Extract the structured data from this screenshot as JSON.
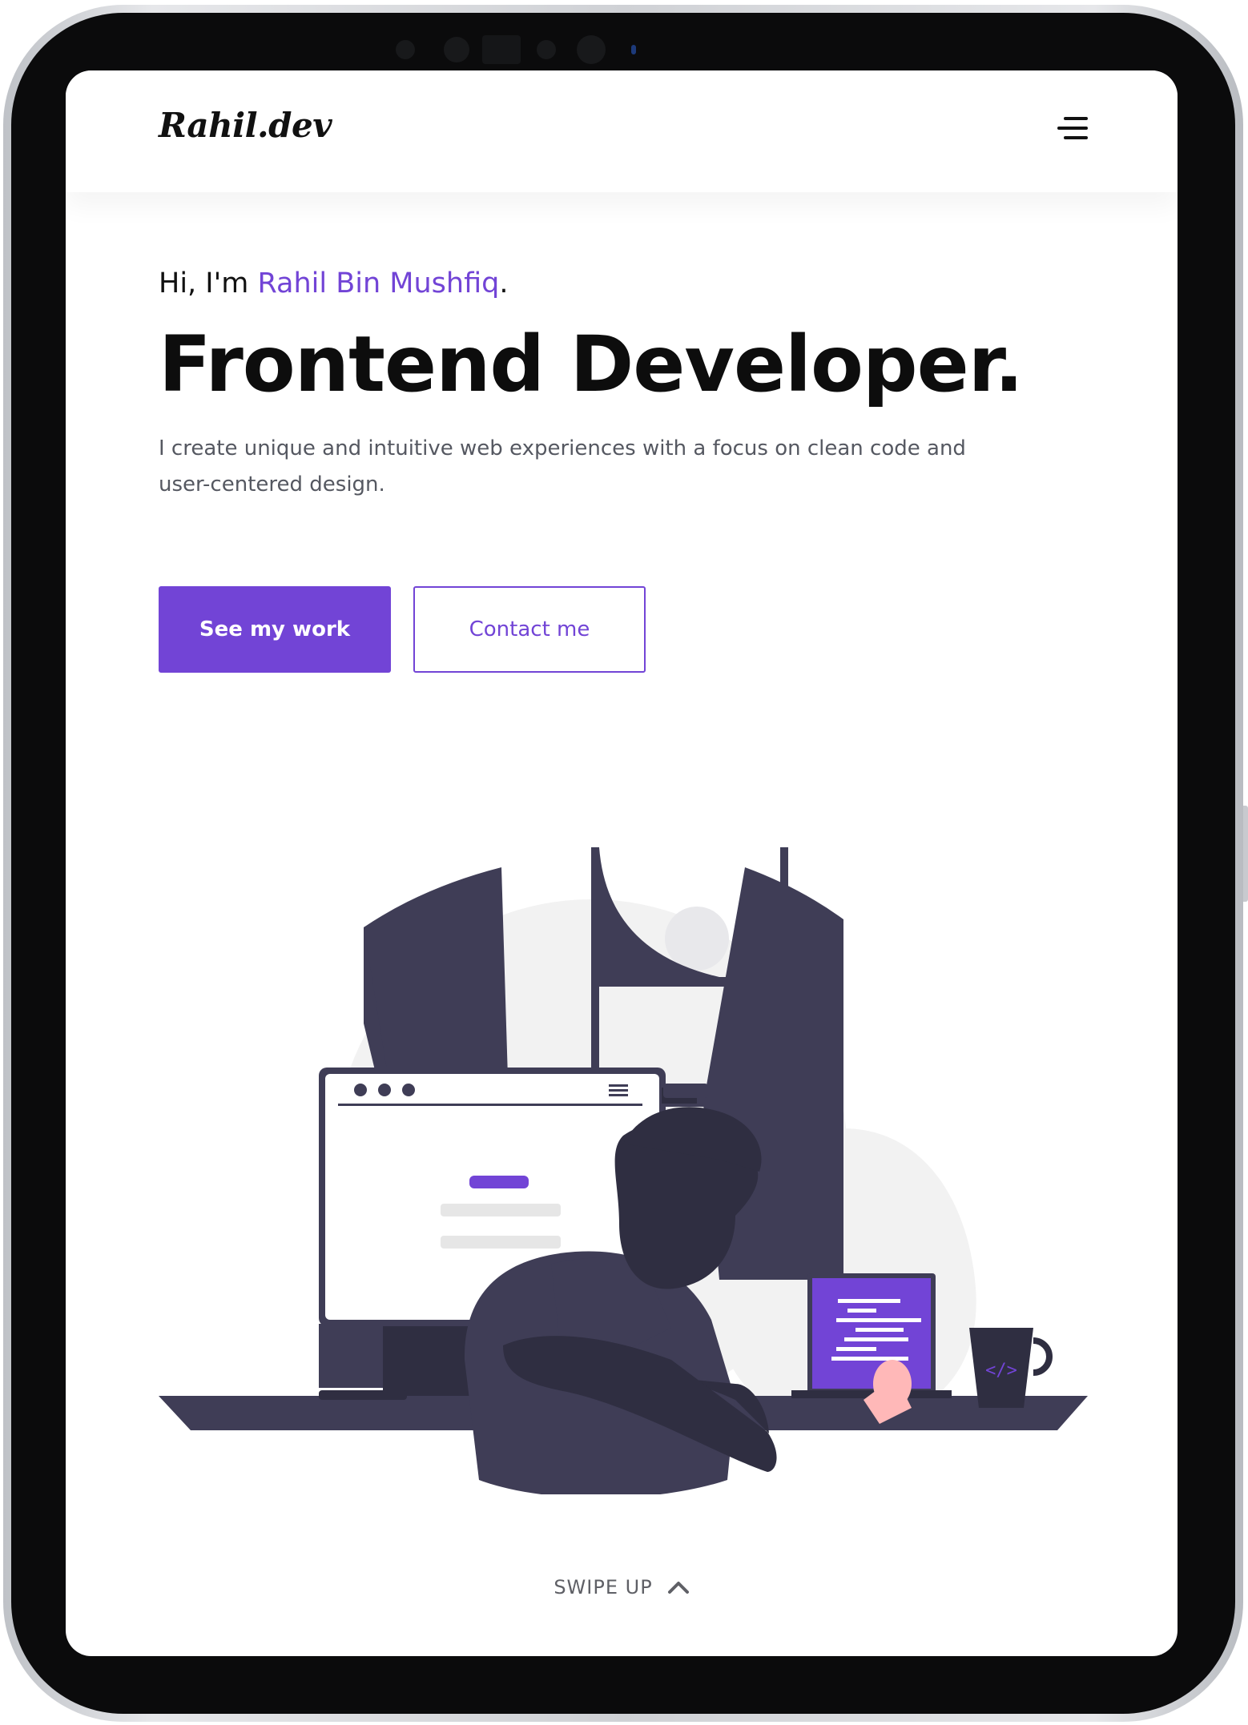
{
  "brand": {
    "logo": "Rahil.dev"
  },
  "header": {
    "menu_icon": "hamburger-menu-icon"
  },
  "hero": {
    "greeting_prefix": "Hi, I'm ",
    "name": "Rahil Bin Mushfiq",
    "greeting_suffix": ".",
    "headline": "Frontend Developer.",
    "subtext": "I create unique and intuitive web experiences with a focus on clean code and user-centered design."
  },
  "actions": {
    "primary_label": "See my work",
    "secondary_label": "Contact me"
  },
  "footer": {
    "swipe_label": "SWIPE UP",
    "swipe_icon": "chevron-up-icon"
  },
  "colors": {
    "accent": "#7244d6",
    "illustration_dark": "#3f3d56",
    "illustration_hair": "#2f2e41",
    "illustration_bg": "#f2f2f2",
    "skin": "#ffb8b8"
  }
}
